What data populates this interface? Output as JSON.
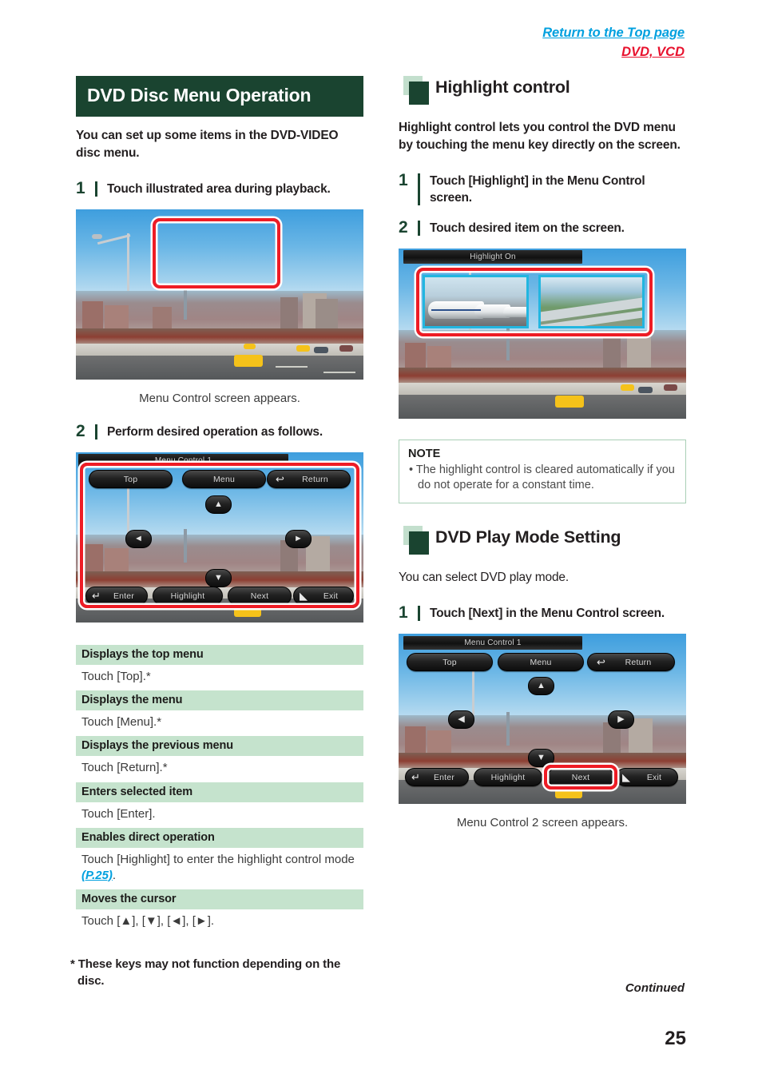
{
  "top_links": {
    "return_top": "Return to the Top page",
    "media": "DVD, VCD"
  },
  "left_column": {
    "banner_title": "DVD Disc Menu Operation",
    "intro": "You can set up some items in the DVD-VIDEO disc menu.",
    "step1_num": "1",
    "step1_text": "Touch illustrated area during playback.",
    "caption1": "Menu Control screen appears.",
    "step2_num": "2",
    "step2_text": "Perform desired operation as follows.",
    "screenshot1": {
      "name": "dvd-playback-photo"
    },
    "screenshot2": {
      "title": "Menu Control 1",
      "buttons_top": [
        "Top",
        "Menu",
        "Return"
      ],
      "buttons_bottom": [
        "Enter",
        "Highlight",
        "Next",
        "Exit"
      ],
      "arrows": [
        "▲",
        "◄",
        "►",
        "▼"
      ]
    },
    "definitions": [
      {
        "head": "Displays the top menu",
        "body": "Touch [Top].*"
      },
      {
        "head": "Displays the menu",
        "body": "Touch [Menu].*"
      },
      {
        "head": "Displays the previous menu",
        "body": "Touch [Return].*"
      },
      {
        "head": "Enters selected item",
        "body": "Touch [Enter]."
      },
      {
        "head": "Enables direct operation",
        "body_pre": "Touch [Highlight] to enter the highlight control mode ",
        "body_link": "(P.25)",
        "body_post": "."
      },
      {
        "head": "Moves the cursor",
        "body": "Touch [▲], [▼], [◄], [►]."
      }
    ],
    "footnote": "* These keys may not function depending on the disc."
  },
  "right_column": {
    "section1_title": "Highlight control",
    "section1_intro": "Highlight control lets you control the DVD menu by touching the menu key directly on the screen.",
    "s1_step1_num": "1",
    "s1_step1_text": "Touch [Highlight] in the Menu Control screen.",
    "s1_step2_num": "2",
    "s1_step2_text": "Touch desired item on the screen.",
    "screenshot_highlight": {
      "title": "Highlight On",
      "thumb1_name": "bullet-train-thumbnail",
      "thumb2_name": "aerial-highway-thumbnail"
    },
    "note": {
      "title": "NOTE",
      "items": [
        "• The highlight control is cleared automatically if you do not operate for a constant time."
      ]
    },
    "section2_title": "DVD Play Mode Setting",
    "section2_intro": "You can select DVD play mode.",
    "s2_step1_num": "1",
    "s2_step1_text": "Touch [Next] in the Menu Control screen.",
    "screenshot_menu2": {
      "title": "Menu Control 1",
      "buttons_top": [
        "Top",
        "Menu",
        "Return"
      ],
      "buttons_bottom": [
        "Enter",
        "Highlight",
        "Next",
        "Exit"
      ],
      "highlighted_button": "Next"
    },
    "caption2": "Menu Control 2 screen appears."
  },
  "footer": {
    "continued": "Continued",
    "page_number": "25"
  },
  "colors": {
    "dark_green": "#1a4430",
    "light_green": "#c5e3cd",
    "link_blue": "#00a0df",
    "link_red": "#e8112d",
    "highlight_red": "#ee1c25",
    "thumb_cyan": "#22b6e0"
  }
}
